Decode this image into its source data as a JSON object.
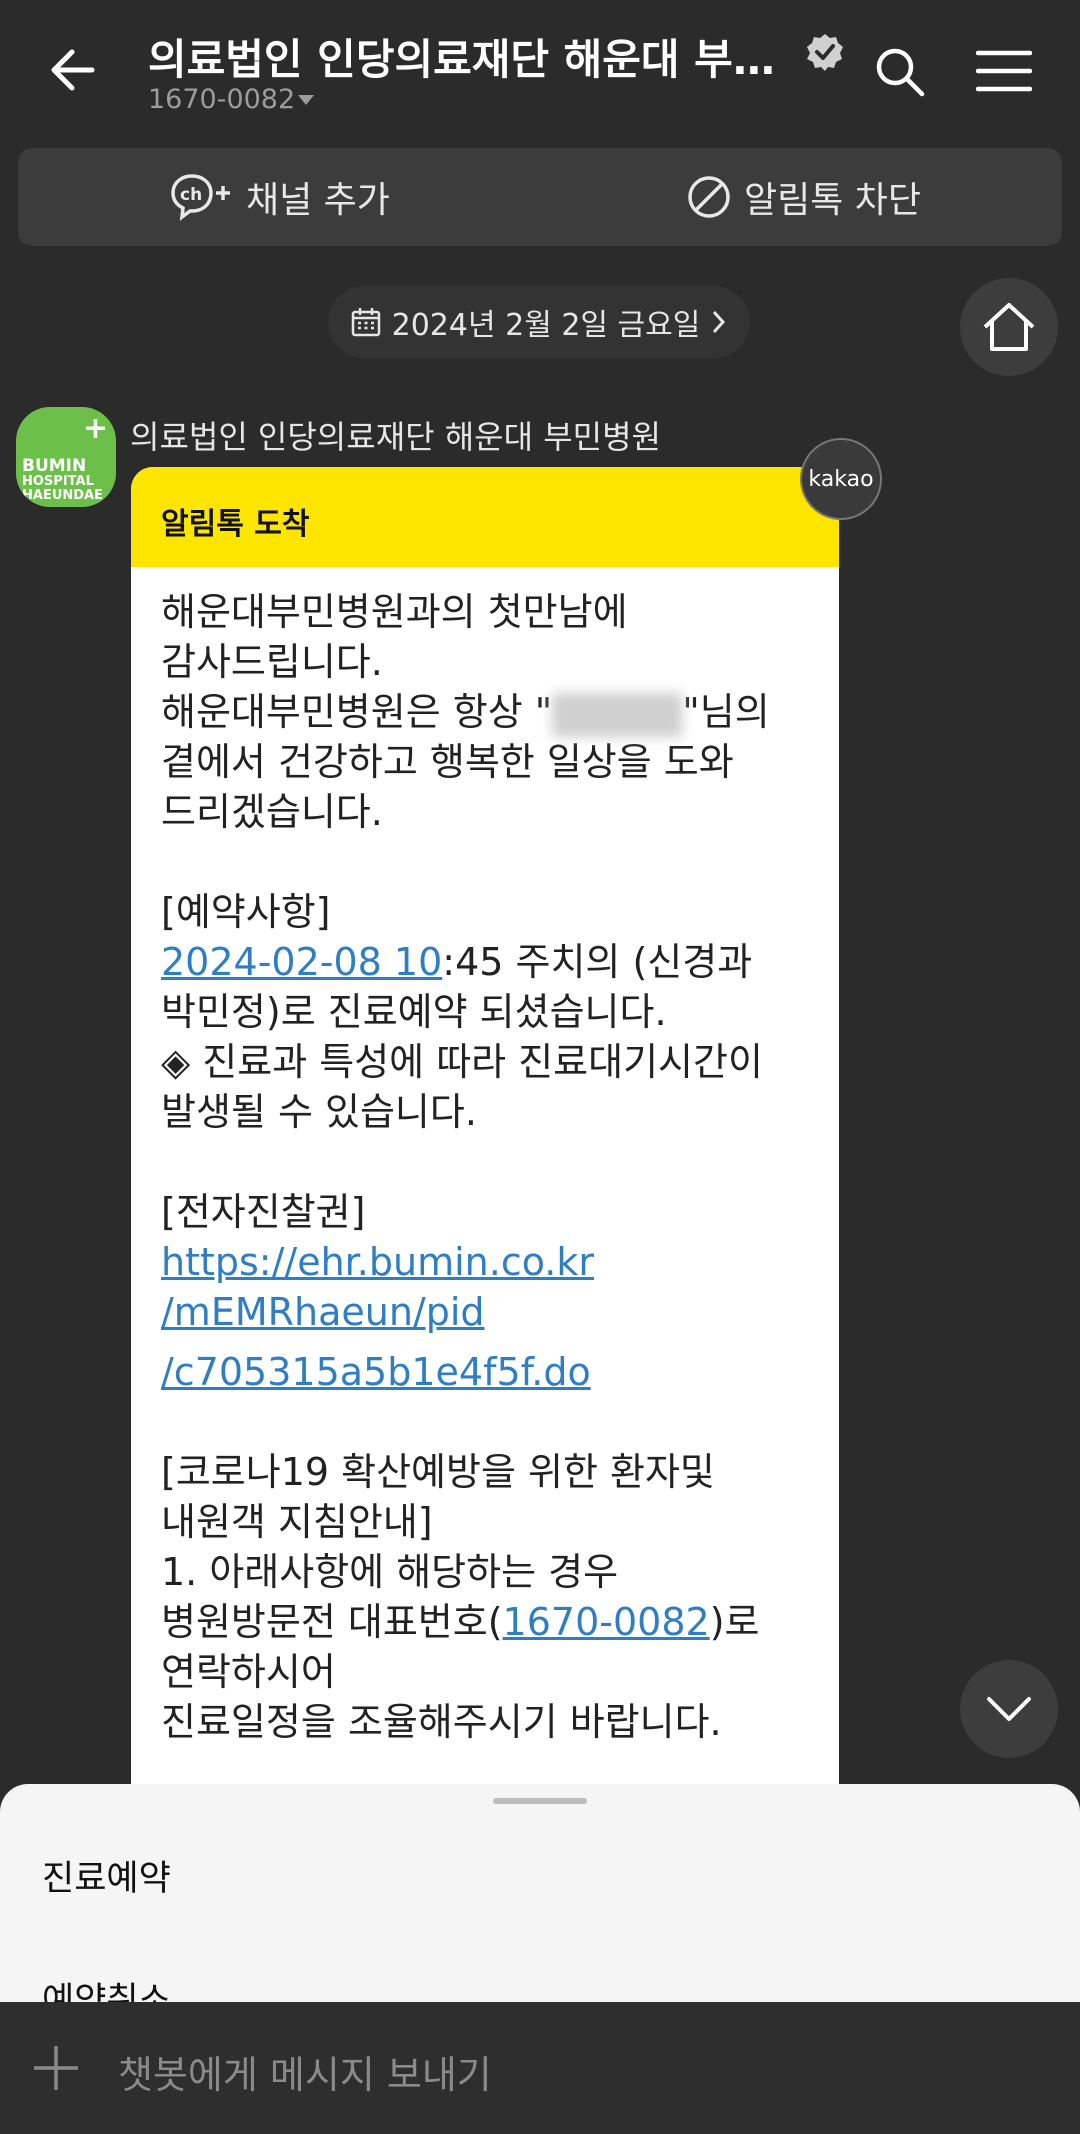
{
  "header": {
    "title": "의료법인 인당의료재단 해운대 부민...",
    "phone": "1670-0082"
  },
  "actions": {
    "add_channel": "채널 추가",
    "block_alimtalk": "알림톡 차단"
  },
  "date_pill": "2024년 2월 2일 금요일",
  "sender": {
    "name": "의료법인 인당의료재단 해운대 부민병원",
    "avatar_text": [
      "BUMIN",
      "HOSPITAL",
      "HAEUNDAE"
    ],
    "avatar_plus": "+"
  },
  "message": {
    "badge": "kakao",
    "header": "알림톡 도착",
    "greeting_1": "해운대부민병원과의 첫만남에",
    "greeting_2": "감사드립니다.",
    "greeting_3a": "해운대부민병원은 항상 \"",
    "greeting_3b": "\"님의",
    "greeting_4": "곁에서 건강하고 행복한 일상을 도와",
    "greeting_5": "드리겠습니다.",
    "reservation_title": "[예약사항]",
    "reservation_date_link": "2024-02-08 10",
    "reservation_rest": ":45  주치의 (신경과",
    "reservation_line2": "박민정)로 진료예약 되셨습니다.",
    "notice_1": "◈ 진료과 특성에 따라 진료대기시간이",
    "notice_2": "발생될 수 있습니다.",
    "ticket_title": "[전자진찰권]",
    "ticket_link_1": "https://ehr.bumin.co.kr",
    "ticket_link_2": "/mEMRhaeun/pid",
    "ticket_link_3": "/c705315a5b1e4f5f.do",
    "covid_title_1": "[코로나19  확산예방을 위한 환자및",
    "covid_title_2": "내원객 지침안내]",
    "covid_1": "1. 아래사항에 해당하는 경우",
    "covid_2a": "병원방문전 대표번호(",
    "covid_2_link": "1670-0082",
    "covid_2b": ")로",
    "covid_3": "연락하시어",
    "covid_4": "진료일정을 조율해주시기 바랍니다."
  },
  "sheet": {
    "items": [
      "진료예약",
      "예약취소"
    ]
  },
  "input": {
    "placeholder": "챗봇에게 메시지 보내기"
  }
}
